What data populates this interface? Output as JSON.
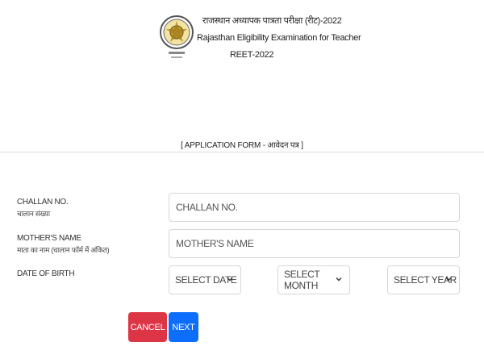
{
  "header": {
    "line1": "राजस्थान अध्यापक पात्रता परीक्षा (रीट)-2022",
    "line2": "Rajasthan Eligibility Examination for Teacher",
    "line3": "REET-2022"
  },
  "form": {
    "caption": "[ APPLICATION FORM - आवेदन पत्र ]",
    "challan_label": "CHALLAN NO.",
    "challan_label_hi": "चालान संख्या",
    "challan_placeholder": "CHALLAN NO.",
    "challan_value": "",
    "mother_label": "MOTHER'S NAME",
    "mother_label_hi": "माता का नाम (चालान फॉर्म में अंकित)",
    "mother_placeholder": "MOTHER'S NAME",
    "mother_value": "",
    "dob_label": "DATE OF BIRTH",
    "date_select": "SELECT DATE",
    "month_select": "SELECT MONTH",
    "year_select": "SELECT YEAR"
  },
  "buttons": {
    "cancel": "CANCEL",
    "next": "NEXT"
  },
  "colors": {
    "cancel": "#dc3545",
    "next": "#0d6efd"
  },
  "icons": {
    "logo": "emblem-logo-icon",
    "dropdown": "chevron-down-icon"
  }
}
